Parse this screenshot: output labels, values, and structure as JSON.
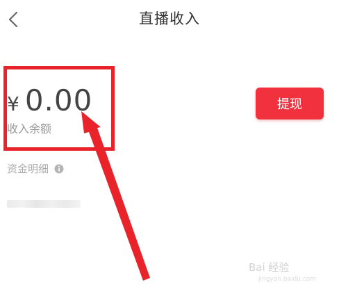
{
  "header": {
    "title": "直播收入",
    "back_icon": "chevron-left-icon"
  },
  "balance": {
    "currency": "¥",
    "amount": "0.00",
    "label": "收入余额"
  },
  "actions": {
    "withdraw_label": "提现"
  },
  "details": {
    "label": "资金明细",
    "info_icon": "info-icon"
  },
  "watermark": {
    "text": "Bai 经验",
    "sub": "jingyan.baidu.com"
  },
  "colors": {
    "accent": "#f2313f",
    "annotation": "#e8232a"
  }
}
